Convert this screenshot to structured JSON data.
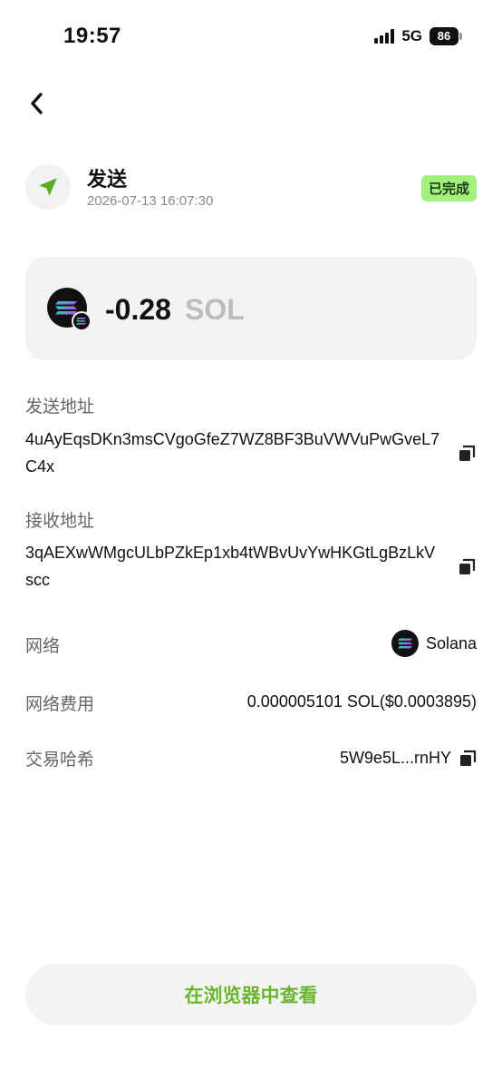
{
  "status_bar": {
    "time": "19:57",
    "network": "5G",
    "battery": "86"
  },
  "transaction": {
    "type_label": "发送",
    "datetime": "2026-07-13 16:07:30",
    "status": "已完成",
    "amount": "-0.28",
    "unit": "SOL"
  },
  "fields": {
    "sender_label": "发送地址",
    "sender_address": "4uAyEqsDKn3msCVgoGfeZ7WZ8BF3BuVWVuPwGveL7C4x",
    "receiver_label": "接收地址",
    "receiver_address": "3qAEXwWMgcULbPZkEp1xb4tWBvUvYwHKGtLgBzLkVscc",
    "network_label": "网络",
    "network_value": "Solana",
    "fee_label": "网络费用",
    "fee_value": "0.000005101 SOL($0.0003895)",
    "hash_label": "交易哈希",
    "hash_value": "5W9e5L...rnHY"
  },
  "actions": {
    "explorer_button": "在浏览器中查看"
  },
  "colors": {
    "accent_green": "#6cb52e",
    "badge_green": "#a3f07e",
    "card_bg": "#f3f3f3"
  }
}
